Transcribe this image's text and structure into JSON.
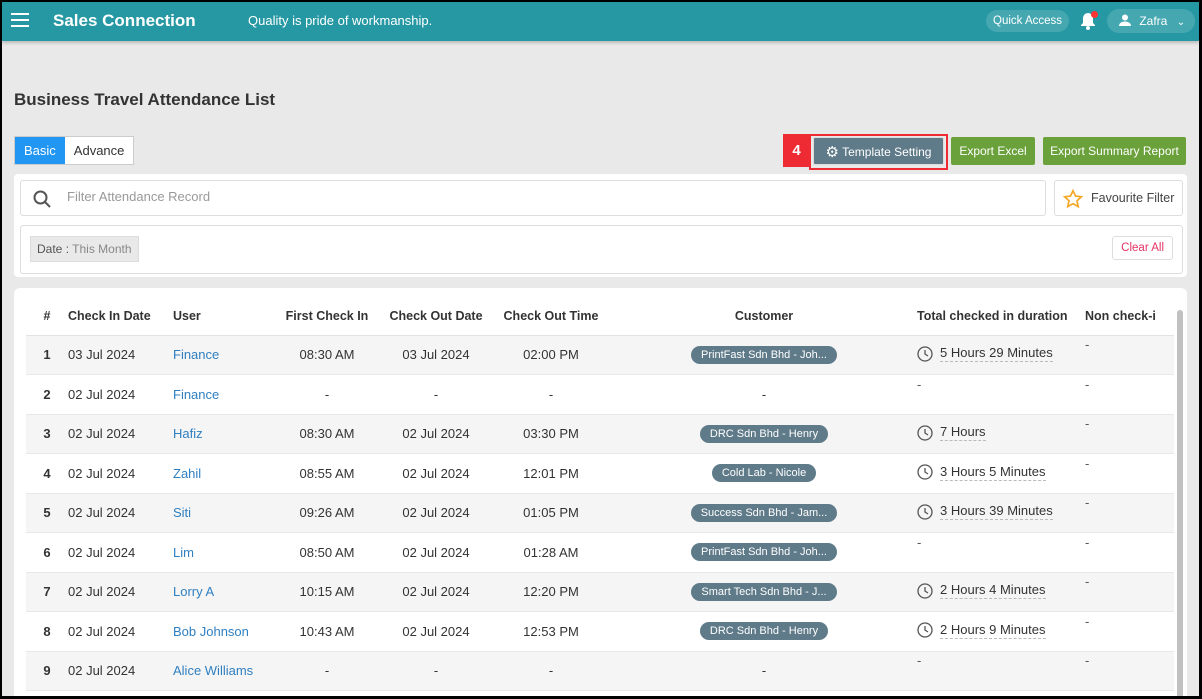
{
  "app": {
    "title": "Sales Connection",
    "tagline": "Quality is pride of workmanship.",
    "quick_access": "Quick Access",
    "user": "Zafra",
    "accent": "#2598a3"
  },
  "page": {
    "title": "Business Travel Attendance List",
    "tabs": [
      {
        "label": "Basic",
        "active": true
      },
      {
        "label": "Advance",
        "active": false
      }
    ],
    "step_badge": "4",
    "buttons": {
      "template": "Template Setting",
      "export_excel": "Export Excel",
      "export_summary": "Export Summary Report"
    }
  },
  "filter": {
    "placeholder": "Filter Attendance Record",
    "favourite": "Favourite Filter",
    "chip_label": "Date",
    "chip_sep": ":",
    "chip_value": "This Month",
    "clear_all": "Clear All"
  },
  "table": {
    "columns": [
      "#",
      "Check In Date",
      "User",
      "First Check In",
      "Check Out Date",
      "Check Out Time",
      "Customer",
      "Total checked in duration",
      "Non check-i"
    ],
    "rows": [
      {
        "n": "1",
        "in_date": "03 Jul 2024",
        "user": "Finance",
        "first_in": "08:30 AM",
        "out_date": "03 Jul 2024",
        "out_time": "02:00 PM",
        "customer": "PrintFast Sdn Bhd - Joh...",
        "duration": "5 Hours 29 Minutes",
        "non": "-"
      },
      {
        "n": "2",
        "in_date": "02 Jul 2024",
        "user": "Finance",
        "first_in": "-",
        "out_date": "-",
        "out_time": "-",
        "customer": "",
        "duration": "",
        "non": "-"
      },
      {
        "n": "3",
        "in_date": "02 Jul 2024",
        "user": "Hafiz",
        "first_in": "08:30 AM",
        "out_date": "02 Jul 2024",
        "out_time": "03:30 PM",
        "customer": "DRC Sdn Bhd - Henry",
        "duration": "7 Hours",
        "non": "-"
      },
      {
        "n": "4",
        "in_date": "02 Jul 2024",
        "user": "Zahil",
        "first_in": "08:55 AM",
        "out_date": "02 Jul 2024",
        "out_time": "12:01 PM",
        "customer": "Cold Lab - Nicole",
        "duration": "3 Hours 5 Minutes",
        "non": "-"
      },
      {
        "n": "5",
        "in_date": "02 Jul 2024",
        "user": "Siti",
        "first_in": "09:26 AM",
        "out_date": "02 Jul 2024",
        "out_time": "01:05 PM",
        "customer": "Success Sdn Bhd - Jam...",
        "duration": "3 Hours 39 Minutes",
        "non": "-"
      },
      {
        "n": "6",
        "in_date": "02 Jul 2024",
        "user": "Lim",
        "first_in": "08:50 AM",
        "out_date": "02 Jul 2024",
        "out_time": "01:28 AM",
        "customer": "PrintFast Sdn Bhd - Joh...",
        "duration": "",
        "non": "-"
      },
      {
        "n": "7",
        "in_date": "02 Jul 2024",
        "user": "Lorry A",
        "first_in": "10:15 AM",
        "out_date": "02 Jul 2024",
        "out_time": "12:20 PM",
        "customer": "Smart Tech Sdn Bhd - J...",
        "duration": "2 Hours 4 Minutes",
        "non": "-"
      },
      {
        "n": "8",
        "in_date": "02 Jul 2024",
        "user": "Bob Johnson",
        "first_in": "10:43 AM",
        "out_date": "02 Jul 2024",
        "out_time": "12:53 PM",
        "customer": "DRC Sdn Bhd - Henry",
        "duration": "2 Hours 9 Minutes",
        "non": "-"
      },
      {
        "n": "9",
        "in_date": "02 Jul 2024",
        "user": "Alice Williams",
        "first_in": "-",
        "out_date": "-",
        "out_time": "-",
        "customer": "",
        "duration": "",
        "non": "-"
      }
    ]
  }
}
